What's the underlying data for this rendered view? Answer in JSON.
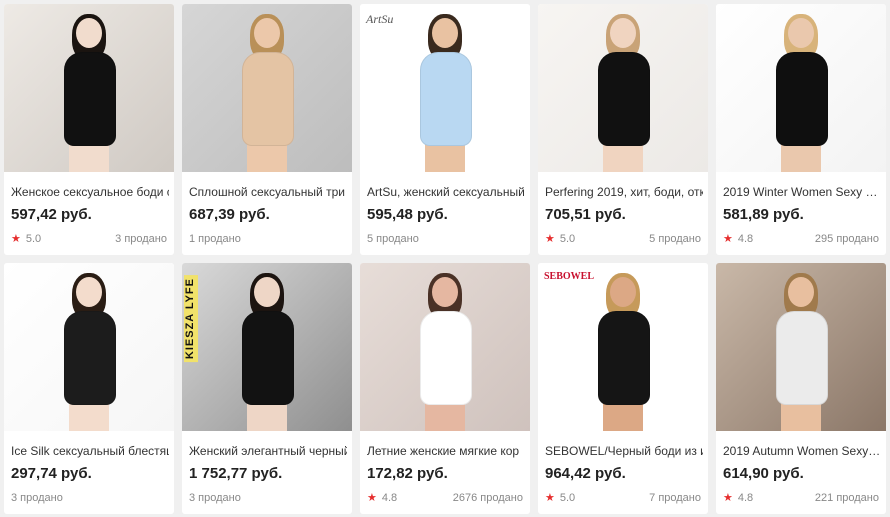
{
  "products": [
    {
      "title": "Женское сексуальное боди с",
      "price": "597,42 руб.",
      "rating": "5.0",
      "sold": "3 продано",
      "brand": "",
      "colors": {
        "bg": "#cfc9c3",
        "bg2": "#eeeae5",
        "outfit": "#111111",
        "skin": "#f1dccd",
        "hair": "#1a1410"
      }
    },
    {
      "title": "Сплошной сексуальный три",
      "price": "687,39 руб.",
      "rating": "",
      "sold": "1 продано",
      "brand": "",
      "colors": {
        "bg": "#bdbdbd",
        "bg2": "#d6d6d6",
        "outfit": "#e4c4a4",
        "skin": "#ecc8aa",
        "hair": "#b99058"
      }
    },
    {
      "title": "ArtSu, женский сексуальный",
      "price": "595,48 руб.",
      "rating": "",
      "sold": "5 продано",
      "brand": "ArtSu",
      "colors": {
        "bg": "#ffffff",
        "bg2": "#ffffff",
        "outfit": "#b9d8f2",
        "skin": "#e9c2a2",
        "hair": "#3a2a1e"
      }
    },
    {
      "title": "Perfering 2019, хит, боди, отк",
      "price": "705,51 руб.",
      "rating": "5.0",
      "sold": "5 продано",
      "brand": "",
      "colors": {
        "bg": "#ece9e6",
        "bg2": "#f7f5f2",
        "outfit": "#111111",
        "skin": "#f0d4c0",
        "hair": "#c9a377"
      }
    },
    {
      "title": "2019 Winter Women Sexy B…",
      "price": "581,89 руб.",
      "rating": "4.8",
      "sold": "295 продано",
      "brand": "",
      "colors": {
        "bg": "#f3f3f3",
        "bg2": "#ffffff",
        "outfit": "#0f0f0f",
        "skin": "#eac8ad",
        "hair": "#d8b37a"
      }
    },
    {
      "title": "Ice Silk сексуальный блестящ",
      "price": "297,74 руб.",
      "rating": "",
      "sold": "3 продано",
      "brand": "",
      "colors": {
        "bg": "#f6f6f6",
        "bg2": "#ffffff",
        "outfit": "#1c1c1c",
        "skin": "#f3dccc",
        "hair": "#2a1d14"
      }
    },
    {
      "title": "Женский элегантный черный",
      "price": "1 752,77 руб.",
      "rating": "",
      "sold": "3 продано",
      "brand": "KIESZA LYFE",
      "colors": {
        "bg": "#8f8f8f",
        "bg2": "#d9d9d9",
        "outfit": "#121212",
        "skin": "#eed6c6",
        "hair": "#1c1410"
      }
    },
    {
      "title": "Летние женские мягкие кор",
      "price": "172,82 руб.",
      "rating": "4.8",
      "sold": "2676 продано",
      "brand": "",
      "colors": {
        "bg": "#cfc2bd",
        "bg2": "#e7ddd8",
        "outfit": "#ffffff",
        "skin": "#e5b7a1",
        "hair": "#4a3126"
      }
    },
    {
      "title": "SEBOWEL/Черный боди из ис",
      "price": "964,42 руб.",
      "rating": "5.0",
      "sold": "7 продано",
      "brand": "SEBOWEL",
      "colors": {
        "bg": "#ffffff",
        "bg2": "#ffffff",
        "outfit": "#151515",
        "skin": "#dca885",
        "hair": "#c69a5a"
      }
    },
    {
      "title": "2019 Autumn Women Sexy …",
      "price": "614,90 руб.",
      "rating": "4.8",
      "sold": "221 продано",
      "brand": "",
      "colors": {
        "bg": "#8b7768",
        "bg2": "#c9b8a8",
        "outfit": "#ebebeb",
        "skin": "#e8bf9f",
        "hair": "#a07a4c"
      }
    }
  ]
}
